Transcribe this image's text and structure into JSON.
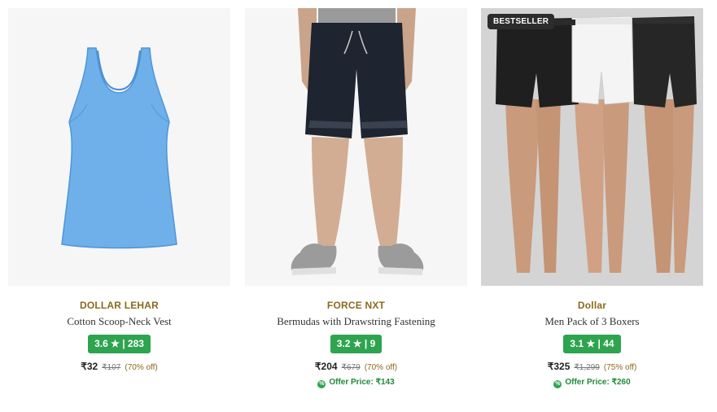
{
  "products": [
    {
      "brand": "DOLLAR LEHAR",
      "name": "Cotton Scoop-Neck Vest",
      "rating": "3.6",
      "reviews": "283",
      "price": "₹32",
      "mrp": "₹107",
      "discount": "(70% off)",
      "image_icon": "blue-vest-icon"
    },
    {
      "brand": "FORCE NXT",
      "name": "Bermudas with Drawstring Fastening",
      "rating": "3.2",
      "reviews": "9",
      "price": "₹204",
      "mrp": "₹679",
      "discount": "(70% off)",
      "offer_price": "Offer Price: ₹143",
      "image_icon": "navy-shorts-icon"
    },
    {
      "brand": "Dollar",
      "name": "Men Pack of 3 Boxers",
      "rating": "3.1",
      "reviews": "44",
      "price": "₹325",
      "mrp": "₹1,299",
      "discount": "(75% off)",
      "offer_price": "Offer Price: ₹260",
      "badge": "BESTSELLER",
      "image_icon": "boxers-pack-icon"
    }
  ],
  "colors": {
    "rating_green": "#2ea44f",
    "brand_gold": "#8a6a1d",
    "offer_green": "#1f8a3a",
    "badge_dark": "#2c2c2c"
  }
}
